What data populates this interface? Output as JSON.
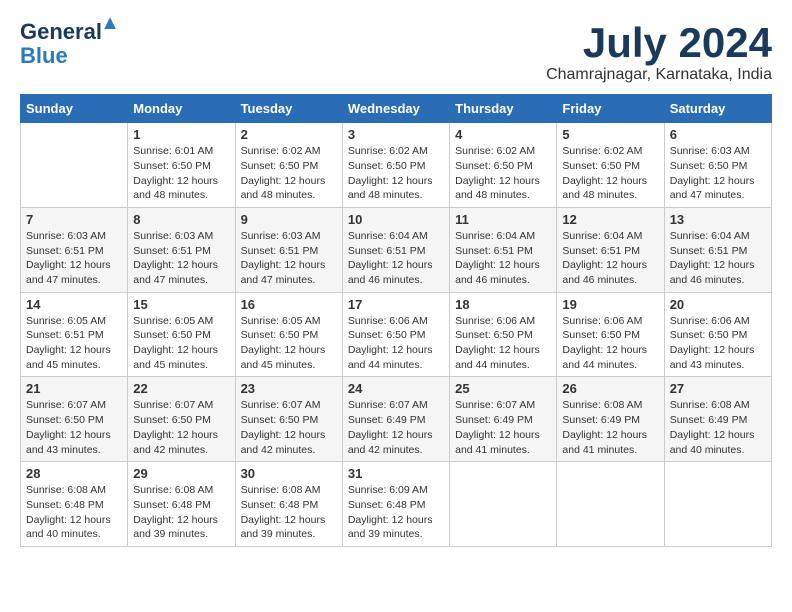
{
  "header": {
    "logo_general": "General",
    "logo_blue": "Blue",
    "title": "July 2024",
    "subtitle": "Chamrajnagar, Karnataka, India"
  },
  "calendar": {
    "weekdays": [
      "Sunday",
      "Monday",
      "Tuesday",
      "Wednesday",
      "Thursday",
      "Friday",
      "Saturday"
    ],
    "rows": [
      [
        {
          "day": "",
          "detail": ""
        },
        {
          "day": "1",
          "detail": "Sunrise: 6:01 AM\nSunset: 6:50 PM\nDaylight: 12 hours\nand 48 minutes."
        },
        {
          "day": "2",
          "detail": "Sunrise: 6:02 AM\nSunset: 6:50 PM\nDaylight: 12 hours\nand 48 minutes."
        },
        {
          "day": "3",
          "detail": "Sunrise: 6:02 AM\nSunset: 6:50 PM\nDaylight: 12 hours\nand 48 minutes."
        },
        {
          "day": "4",
          "detail": "Sunrise: 6:02 AM\nSunset: 6:50 PM\nDaylight: 12 hours\nand 48 minutes."
        },
        {
          "day": "5",
          "detail": "Sunrise: 6:02 AM\nSunset: 6:50 PM\nDaylight: 12 hours\nand 48 minutes."
        },
        {
          "day": "6",
          "detail": "Sunrise: 6:03 AM\nSunset: 6:50 PM\nDaylight: 12 hours\nand 47 minutes."
        }
      ],
      [
        {
          "day": "7",
          "detail": "Sunrise: 6:03 AM\nSunset: 6:51 PM\nDaylight: 12 hours\nand 47 minutes."
        },
        {
          "day": "8",
          "detail": "Sunrise: 6:03 AM\nSunset: 6:51 PM\nDaylight: 12 hours\nand 47 minutes."
        },
        {
          "day": "9",
          "detail": "Sunrise: 6:03 AM\nSunset: 6:51 PM\nDaylight: 12 hours\nand 47 minutes."
        },
        {
          "day": "10",
          "detail": "Sunrise: 6:04 AM\nSunset: 6:51 PM\nDaylight: 12 hours\nand 46 minutes."
        },
        {
          "day": "11",
          "detail": "Sunrise: 6:04 AM\nSunset: 6:51 PM\nDaylight: 12 hours\nand 46 minutes."
        },
        {
          "day": "12",
          "detail": "Sunrise: 6:04 AM\nSunset: 6:51 PM\nDaylight: 12 hours\nand 46 minutes."
        },
        {
          "day": "13",
          "detail": "Sunrise: 6:04 AM\nSunset: 6:51 PM\nDaylight: 12 hours\nand 46 minutes."
        }
      ],
      [
        {
          "day": "14",
          "detail": "Sunrise: 6:05 AM\nSunset: 6:51 PM\nDaylight: 12 hours\nand 45 minutes."
        },
        {
          "day": "15",
          "detail": "Sunrise: 6:05 AM\nSunset: 6:50 PM\nDaylight: 12 hours\nand 45 minutes."
        },
        {
          "day": "16",
          "detail": "Sunrise: 6:05 AM\nSunset: 6:50 PM\nDaylight: 12 hours\nand 45 minutes."
        },
        {
          "day": "17",
          "detail": "Sunrise: 6:06 AM\nSunset: 6:50 PM\nDaylight: 12 hours\nand 44 minutes."
        },
        {
          "day": "18",
          "detail": "Sunrise: 6:06 AM\nSunset: 6:50 PM\nDaylight: 12 hours\nand 44 minutes."
        },
        {
          "day": "19",
          "detail": "Sunrise: 6:06 AM\nSunset: 6:50 PM\nDaylight: 12 hours\nand 44 minutes."
        },
        {
          "day": "20",
          "detail": "Sunrise: 6:06 AM\nSunset: 6:50 PM\nDaylight: 12 hours\nand 43 minutes."
        }
      ],
      [
        {
          "day": "21",
          "detail": "Sunrise: 6:07 AM\nSunset: 6:50 PM\nDaylight: 12 hours\nand 43 minutes."
        },
        {
          "day": "22",
          "detail": "Sunrise: 6:07 AM\nSunset: 6:50 PM\nDaylight: 12 hours\nand 42 minutes."
        },
        {
          "day": "23",
          "detail": "Sunrise: 6:07 AM\nSunset: 6:50 PM\nDaylight: 12 hours\nand 42 minutes."
        },
        {
          "day": "24",
          "detail": "Sunrise: 6:07 AM\nSunset: 6:49 PM\nDaylight: 12 hours\nand 42 minutes."
        },
        {
          "day": "25",
          "detail": "Sunrise: 6:07 AM\nSunset: 6:49 PM\nDaylight: 12 hours\nand 41 minutes."
        },
        {
          "day": "26",
          "detail": "Sunrise: 6:08 AM\nSunset: 6:49 PM\nDaylight: 12 hours\nand 41 minutes."
        },
        {
          "day": "27",
          "detail": "Sunrise: 6:08 AM\nSunset: 6:49 PM\nDaylight: 12 hours\nand 40 minutes."
        }
      ],
      [
        {
          "day": "28",
          "detail": "Sunrise: 6:08 AM\nSunset: 6:48 PM\nDaylight: 12 hours\nand 40 minutes."
        },
        {
          "day": "29",
          "detail": "Sunrise: 6:08 AM\nSunset: 6:48 PM\nDaylight: 12 hours\nand 39 minutes."
        },
        {
          "day": "30",
          "detail": "Sunrise: 6:08 AM\nSunset: 6:48 PM\nDaylight: 12 hours\nand 39 minutes."
        },
        {
          "day": "31",
          "detail": "Sunrise: 6:09 AM\nSunset: 6:48 PM\nDaylight: 12 hours\nand 39 minutes."
        },
        {
          "day": "",
          "detail": ""
        },
        {
          "day": "",
          "detail": ""
        },
        {
          "day": "",
          "detail": ""
        }
      ]
    ]
  }
}
